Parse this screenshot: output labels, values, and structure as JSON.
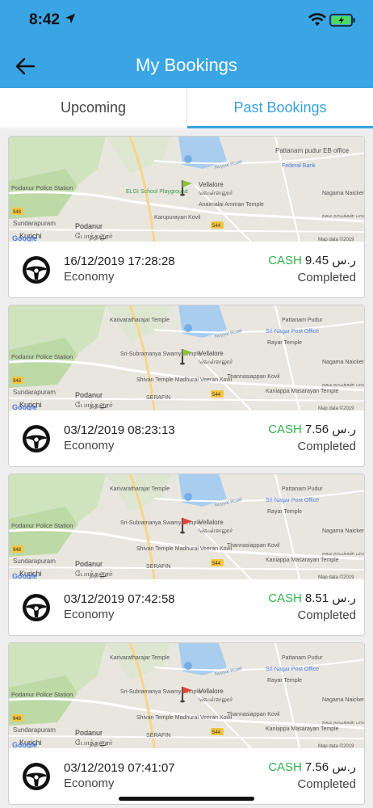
{
  "status_bar": {
    "time": "8:42"
  },
  "header": {
    "title": "My Bookings"
  },
  "tabs": {
    "upcoming": "Upcoming",
    "past": "Past Bookings"
  },
  "colors": {
    "header_bg": "#3aa5e4",
    "accent": "#39a0de",
    "cash": "#2eb34c"
  },
  "map_labels": {
    "pattanam": "Pattanam pudur EB office",
    "pattanam2": "Pattanam Pudur",
    "federal": "Federal Bank",
    "srinagar": "Sri-Nagar Post Office",
    "kariva": "Karivaratharajar Temple",
    "noyyal": "Noyyal Road",
    "elgi": "ELGI School Playground",
    "podanur_ps": "Podanur Police Station",
    "vellalore": "Vellalore",
    "vellalore_ta": "வெள்ளலூர்",
    "anaimalai": "Anaimalai Amman Temple",
    "karupu": "Karupurayan Kovil",
    "nagama": "Nagama Naicken Palayam",
    "nagama_ta": "நகம நாயக்கன் பாளையம்",
    "rayar": "Rayar Temple",
    "srisub": "Sri-Subramanya Swamy Temple",
    "shivan": "Shivan Temple Madhurai Veeran Kovil",
    "thanna": "Thannasiappan Kovil",
    "kaniappa": "Kaniappa Masarayan Temple",
    "serafin": "SERAFIN",
    "sundar": "Sundarapuram",
    "kurichi": "Kurichi",
    "podanur": "Podanur",
    "podanur_ta": "போத்தனூர்",
    "google": "Google",
    "mapdata": "Map data ©2019",
    "road544": "544",
    "road948": "948"
  },
  "bookings": [
    {
      "datetime": "16/12/2019 17:28:28",
      "category": "Economy",
      "payment": "CASH",
      "amount": "9.45 ر.س",
      "status": "Completed",
      "variant": "a",
      "flag_color": "#8bbf3f"
    },
    {
      "datetime": "03/12/2019 08:23:13",
      "category": "Economy",
      "payment": "CASH",
      "amount": "7.56 ر.س",
      "status": "Completed",
      "variant": "b",
      "flag_color": "#8bbf3f"
    },
    {
      "datetime": "03/12/2019 07:42:58",
      "category": "Economy",
      "payment": "CASH",
      "amount": "8.51 ر.س",
      "status": "Completed",
      "variant": "b",
      "flag_color": "#e2453c"
    },
    {
      "datetime": "03/12/2019 07:41:07",
      "category": "Economy",
      "payment": "CASH",
      "amount": "7.56 ر.س",
      "status": "Completed",
      "variant": "b",
      "flag_color": "#e2453c"
    }
  ]
}
